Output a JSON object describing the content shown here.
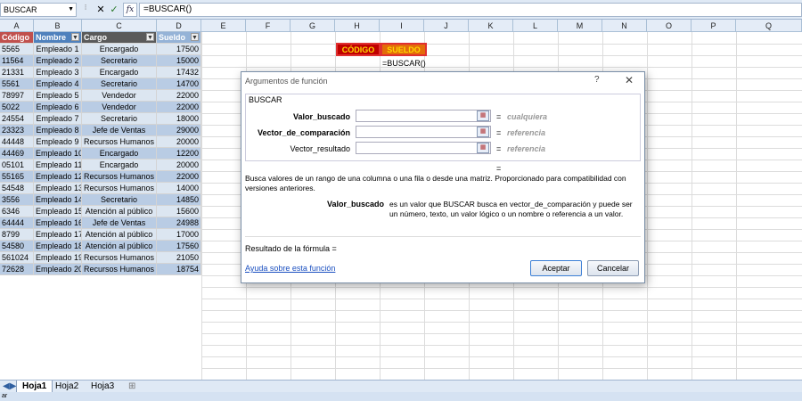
{
  "formula_bar": {
    "name_box": "BUSCAR",
    "formula": "=BUSCAR()",
    "cancel_glyph": "✕",
    "enter_glyph": "✓",
    "fx_label": "fx"
  },
  "columns": [
    "A",
    "B",
    "C",
    "D",
    "E",
    "F",
    "G",
    "H",
    "I",
    "J",
    "K",
    "L",
    "M",
    "N",
    "O",
    "P",
    "Q"
  ],
  "table": {
    "headers": [
      "Código",
      "Nombre",
      "Cargo",
      "Sueldo"
    ],
    "rows": [
      [
        "5565",
        "Empleado 1",
        "Encargado",
        "17500"
      ],
      [
        "11564",
        "Empleado 2",
        "Secretario",
        "15000"
      ],
      [
        "21331",
        "Empleado 3",
        "Encargado",
        "17432"
      ],
      [
        "5561",
        "Empleado 4",
        "Secretario",
        "14700"
      ],
      [
        "78997",
        "Empleado 5",
        "Vendedor",
        "22000"
      ],
      [
        "5022",
        "Empleado 6",
        "Vendedor",
        "22000"
      ],
      [
        "24554",
        "Empleado 7",
        "Secretario",
        "18000"
      ],
      [
        "23323",
        "Empleado 8",
        "Jefe de Ventas",
        "29000"
      ],
      [
        "44448",
        "Empleado 9",
        "Recursos Humanos",
        "20000"
      ],
      [
        "44469",
        "Empleado 10",
        "Encargado",
        "12200"
      ],
      [
        "05101",
        "Empleado 11",
        "Encargado",
        "20000"
      ],
      [
        "55165",
        "Empleado 12",
        "Recursos Humanos",
        "22000"
      ],
      [
        "54548",
        "Empleado 13",
        "Recursos Humanos",
        "14000"
      ],
      [
        "3556",
        "Empleado 14",
        "Secretario",
        "14850"
      ],
      [
        "6346",
        "Empleado 15",
        "Atención al público",
        "15600"
      ],
      [
        "64444",
        "Empleado 16",
        "Jefe de Ventas",
        "24988"
      ],
      [
        "8799",
        "Empleado 17",
        "Atención al público",
        "17000"
      ],
      [
        "54580",
        "Empleado 18",
        "Atención al público",
        "17560"
      ],
      [
        "561024",
        "Empleado 19",
        "Recursos Humanos",
        "21050"
      ],
      [
        "72628",
        "Empleado 20",
        "Recursos Humanos",
        "18754"
      ]
    ]
  },
  "lookup": {
    "codigo_label": "CÓDIGO",
    "sueldo_label": "SUELDO",
    "cell_formula": "=BUSCAR()"
  },
  "dialog": {
    "title": "Argumentos de función",
    "help": "?",
    "close": "✕",
    "function_name": "BUSCAR",
    "args": [
      {
        "label": "Valor_buscado",
        "value": "cualquiera"
      },
      {
        "label": "Vector_de_comparación",
        "value": "referencia"
      },
      {
        "label": "Vector_resultado",
        "value": "referencia"
      }
    ],
    "equals": "=",
    "description": "Busca valores de un rango de una columna o una fila o desde una matriz. Proporcionado para compatibilidad con versiones anteriores.",
    "arg_name": "Valor_buscado",
    "arg_description": "es un valor que BUSCAR busca en vector_de_comparación y puede ser un número, texto, un valor lógico o un nombre o referencia a un valor.",
    "result_label": "Resultado de la fórmula =",
    "help_link": "Ayuda sobre esta función",
    "ok": "Aceptar",
    "cancel": "Cancelar"
  },
  "sheets": [
    "Hoja1",
    "Hoja2",
    "Hoja3"
  ],
  "status_text": "ar"
}
